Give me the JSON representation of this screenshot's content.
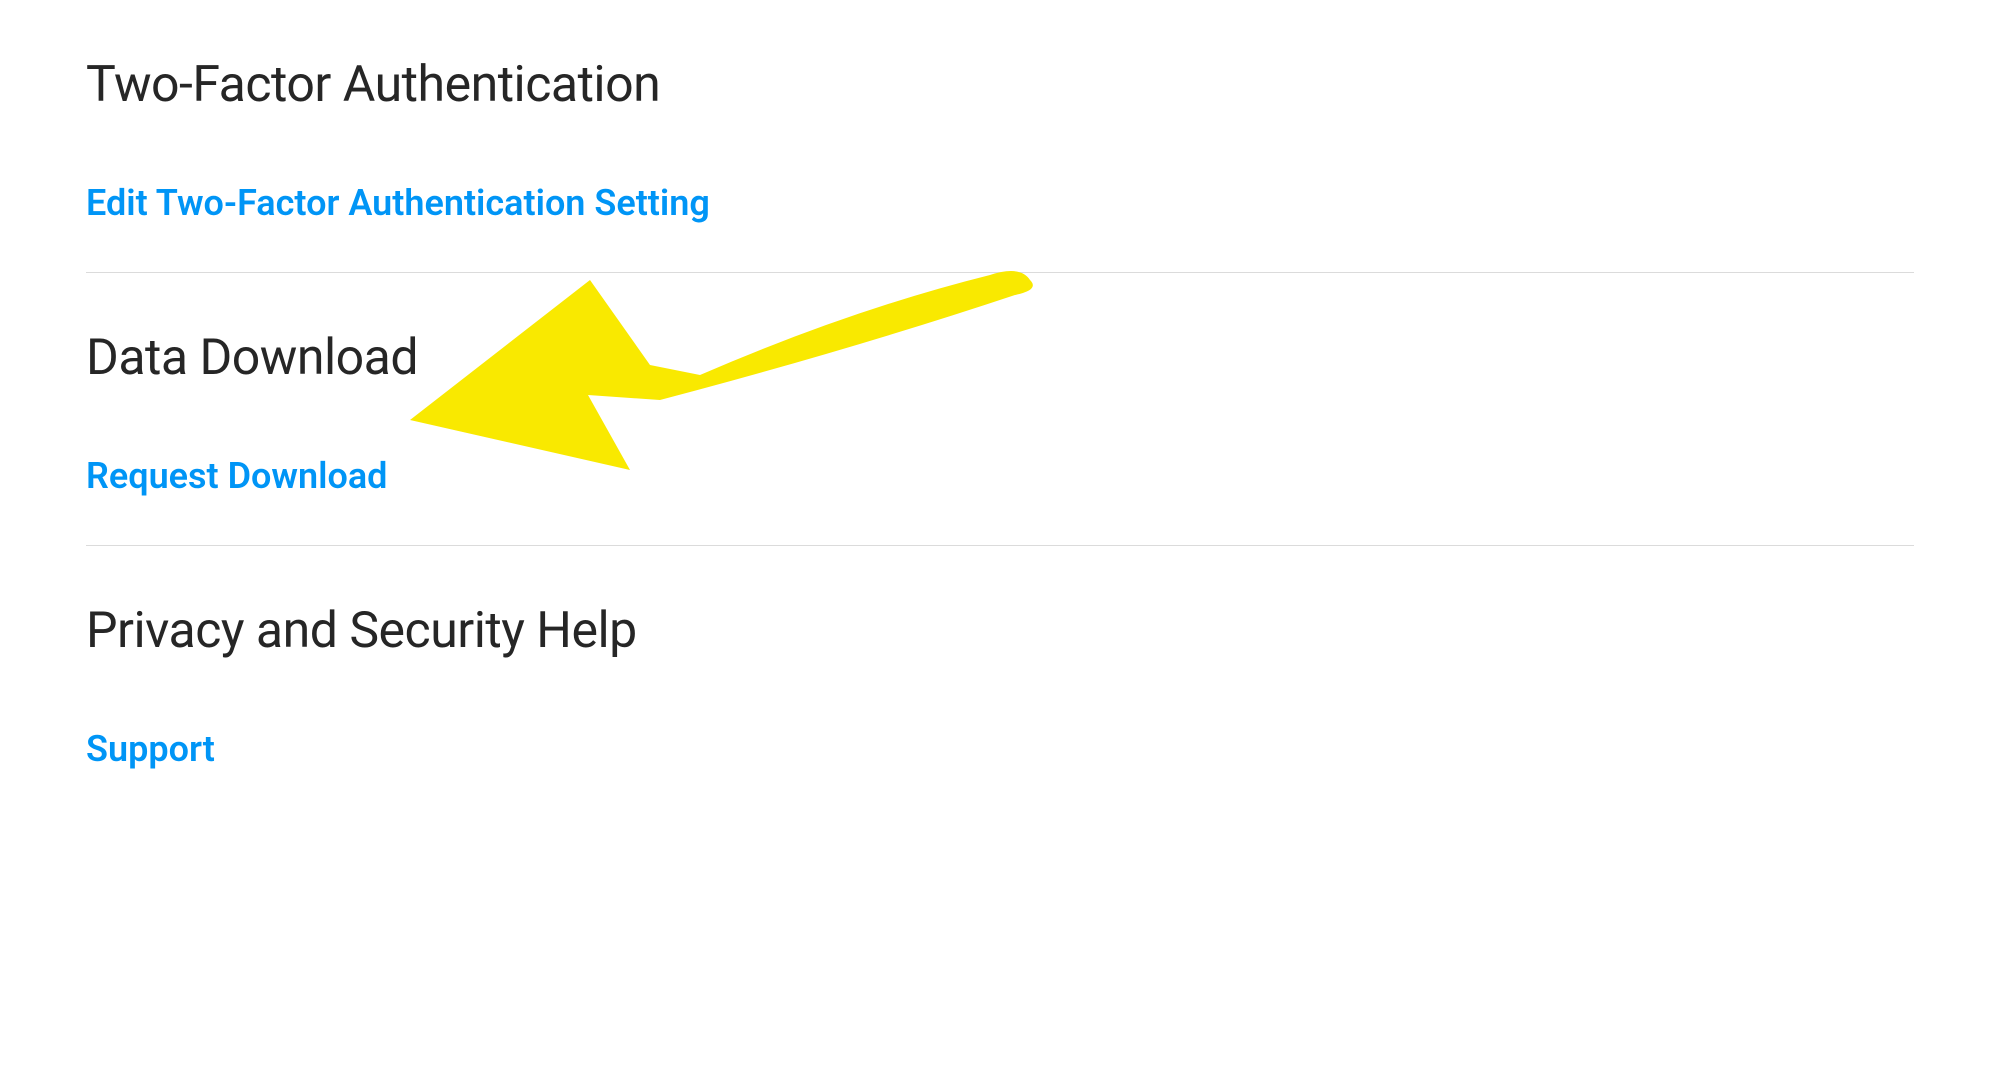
{
  "sections": {
    "twoFactor": {
      "heading": "Two-Factor Authentication",
      "link": "Edit Two-Factor Authentication Setting"
    },
    "dataDownload": {
      "heading": "Data Download",
      "link": "Request Download"
    },
    "privacyHelp": {
      "heading": "Privacy and Security Help",
      "link": "Support"
    }
  },
  "colors": {
    "link": "#0095f6",
    "heading": "#262626",
    "divider": "#dbdbdb",
    "arrowFill": "#f9e900"
  }
}
